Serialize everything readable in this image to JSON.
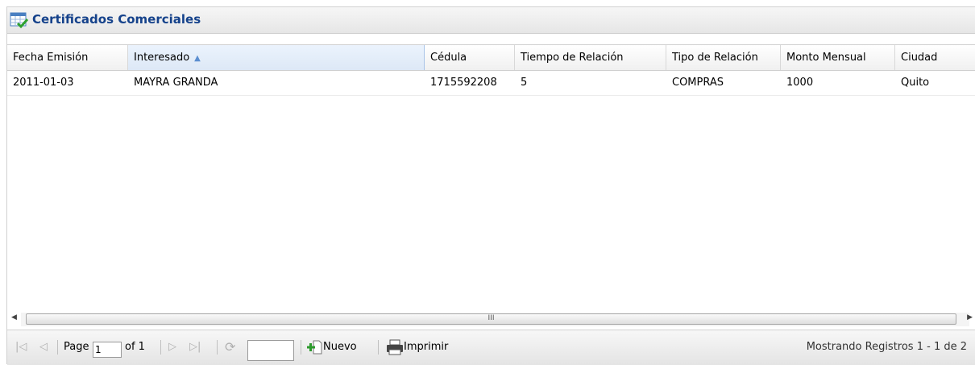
{
  "panel": {
    "title": "Certificados Comerciales",
    "title_icon": "table-check-icon"
  },
  "grid": {
    "sort_column": "Interesado",
    "sort_direction": "asc",
    "columns": [
      "Fecha Emisión",
      "Interesado",
      "Cédula",
      "Tiempo de Relación",
      "Tipo de Relación",
      "Monto Mensual",
      "Ciudad"
    ],
    "rows": [
      [
        "2011-01-03",
        "MAYRA GRANDA",
        "1715592208",
        "5",
        "COMPRAS",
        "1000",
        "Quito"
      ]
    ]
  },
  "scrollbar": {
    "grip": "III"
  },
  "toolbar": {
    "page_label": "Page",
    "page_value": "1",
    "of_label": "of 1",
    "search_value": "",
    "new_label": "Nuevo",
    "print_label": "Imprimir",
    "status": "Mostrando Registros 1 - 1 de 2"
  },
  "colors": {
    "title": "#15428b",
    "sorted_header": "#dde8f6",
    "accent": "#5b8ed0"
  }
}
